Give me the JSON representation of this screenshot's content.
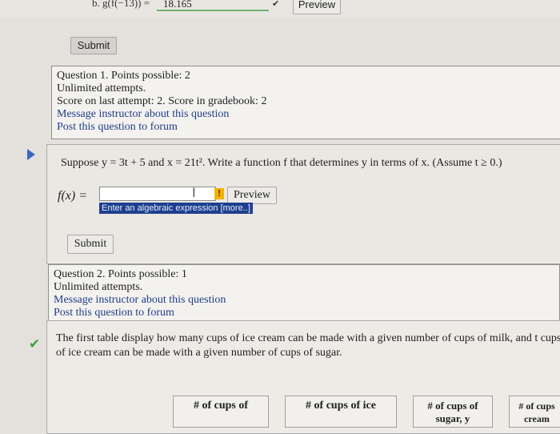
{
  "top": {
    "prev_answer_prefix": "b. g(f(−13)) =",
    "prev_answer_value": "18.165",
    "check_mark": "✔",
    "preview_label": "Preview",
    "submit_label": "Submit"
  },
  "question1_info": {
    "line1": "Question 1. Points possible: 2",
    "line2": "Unlimited attempts.",
    "line3": "Score on last attempt: 2. Score in gradebook: 2",
    "message_link": "Message instructor about this question",
    "post_link": "Post this question to forum"
  },
  "question2": {
    "problem_text": "Suppose y = 3t + 5 and x = 21t². Write a function f that determines y in terms of x. (Assume t ≥ 0.)",
    "f_label": "f(x) =",
    "input_value": "",
    "cursor_glyph": "I",
    "warn_glyph": "!",
    "preview_label": "Preview",
    "tooltip": "Enter an algebraic expression [more..]",
    "submit_label": "Submit"
  },
  "question2_info": {
    "line1": "Question 2. Points possible: 1",
    "line2": "Unlimited attempts.",
    "message_link": "Message instructor about this question",
    "post_link": "Post this question to forum"
  },
  "question3": {
    "check_mark": "✔",
    "text": "The first table display how many cups of ice cream can be made with a given number of cups of milk, and t cups of ice cream can be made with a given number of cups of sugar.",
    "table_headers": [
      "# of cups of",
      "# of cups of ice",
      "# of cups of sugar, y",
      "# of cups cream"
    ]
  },
  "colors": {
    "link": "#1f3d8a",
    "tooltip_bg": "#1d3f8f",
    "arrow": "#3a66c4",
    "check_green": "#3aa53a"
  }
}
